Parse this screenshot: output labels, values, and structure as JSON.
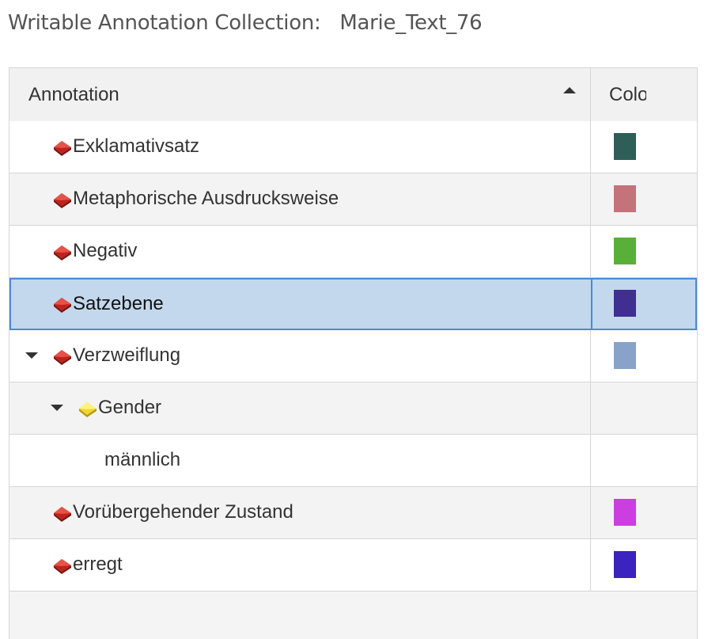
{
  "page": {
    "title": "Writable Annotation Collection:   Marie_Text_76"
  },
  "table": {
    "columns": {
      "annotation": "Annotation",
      "color": "Color"
    },
    "rows": [
      {
        "label": "Exklamativsatz",
        "icon": "tag-red-icon",
        "color": "#2e5e57"
      },
      {
        "label": "Metaphorische Ausdrucksweise",
        "icon": "tag-red-icon",
        "color": "#c4737a"
      },
      {
        "label": "Negativ",
        "icon": "tag-red-icon",
        "color": "#59b038"
      },
      {
        "label": "Satzebene",
        "icon": "tag-red-icon",
        "color": "#402e91",
        "selected": true
      },
      {
        "label": "Verzweiflung",
        "icon": "tag-red-icon",
        "color": "#88a2c9",
        "expanded": true
      },
      {
        "label": "Gender",
        "icon": "property-yellow-icon",
        "expanded": true
      },
      {
        "label": "männlich"
      },
      {
        "label": "Vorübergehender Zustand",
        "icon": "tag-red-icon",
        "color": "#cd3ee0"
      },
      {
        "label": "erregt",
        "icon": "tag-red-icon",
        "color": "#3b23c0"
      }
    ]
  }
}
